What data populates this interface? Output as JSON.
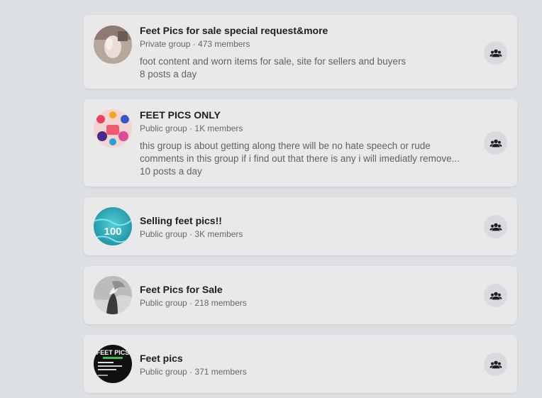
{
  "groups": [
    {
      "name": "Feet Pics for sale special request&more",
      "privacy": "Private group",
      "members": "473 members",
      "description_lines": [
        "foot content and worn items for sale, site for sellers and buyers"
      ],
      "activity": "8 posts a day"
    },
    {
      "name": "FEET PICS ONLY",
      "privacy": "Public group",
      "members": "1K members",
      "description_lines": [
        "this group is about getting along there will be no hate speech or rude",
        "comments in this group if i find out that there is any i will imediatly remove..."
      ],
      "activity": "10 posts a day"
    },
    {
      "name": "Selling feet pics!!",
      "privacy": "Public group",
      "members": "3K members",
      "avatar_text": "100"
    },
    {
      "name": "Feet Pics for Sale",
      "privacy": "Public group",
      "members": "218 members"
    },
    {
      "name": "Feet pics",
      "privacy": "Public group",
      "members": "371 members",
      "avatar_text": "FEET PICS"
    }
  ],
  "meta_separator": " · ",
  "icons": {
    "join": "group-join-icon"
  },
  "colors": {
    "background": "#dcdfe3",
    "card": "#e9e9ea",
    "title": "#1c1e21",
    "secondary": "#65676b"
  }
}
